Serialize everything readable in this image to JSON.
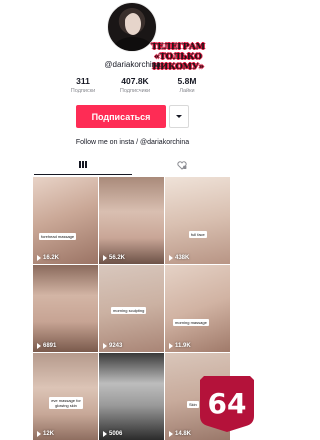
{
  "profile": {
    "username": "@dariakorchina",
    "bio": "Follow me on insta / @dariakorchina"
  },
  "promo": {
    "line1": "ТЕЛЕГРАМ",
    "line2": "«ТОЛЬКО",
    "line3": "НИКОМУ»"
  },
  "stats": [
    {
      "value": "311",
      "label": "Подписки"
    },
    {
      "value": "407.8K",
      "label": "Подписчики"
    },
    {
      "value": "5.8M",
      "label": "Лайки"
    }
  ],
  "actions": {
    "follow_label": "Подписаться"
  },
  "tabs": {
    "videos_icon": "grid-icon",
    "liked_icon": "heart-lock-icon"
  },
  "videos": [
    {
      "views": "16.2K",
      "caption": "forehead massage"
    },
    {
      "views": "56.2K",
      "caption": ""
    },
    {
      "views": "438K",
      "caption": "full face"
    },
    {
      "views": "6891",
      "caption": ""
    },
    {
      "views": "9243",
      "caption": "morning sculpting"
    },
    {
      "views": "11.9K",
      "caption": "morning massage"
    },
    {
      "views": "12K",
      "caption": "eve massage for glowing skin"
    },
    {
      "views": "5006",
      "caption": ""
    },
    {
      "views": "14.8K",
      "caption": "Skin"
    }
  ],
  "overlay_badge": {
    "text": "64",
    "color": "#b4123a"
  },
  "colors": {
    "accent": "#fe2c55",
    "text": "#161823",
    "muted": "#8a8b91"
  }
}
